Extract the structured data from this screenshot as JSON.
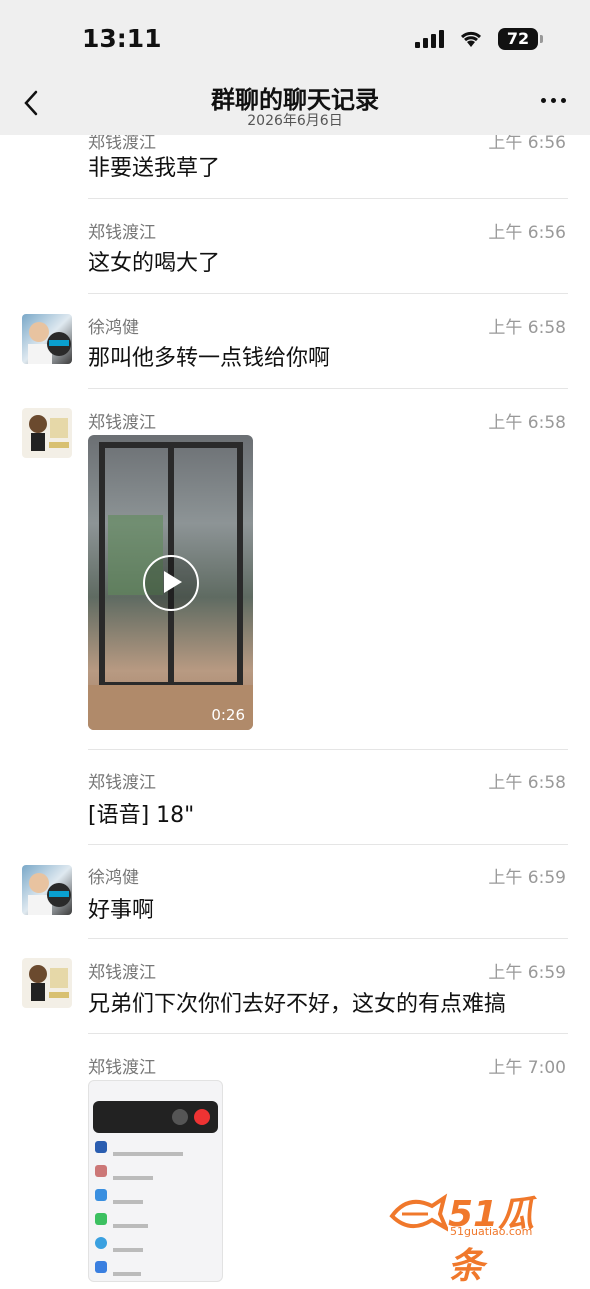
{
  "status_bar": {
    "time": "13:11",
    "battery": "72"
  },
  "header": {
    "title": "群聊的聊天记录",
    "date": "2026年6月6日"
  },
  "messages": [
    {
      "sender": "郑钱渡江",
      "time": "上午 6:56",
      "text": "非要送我草了"
    },
    {
      "sender": "郑钱渡江",
      "time": "上午 6:56",
      "text": "这女的喝大了"
    },
    {
      "sender": "徐鸿健",
      "time": "上午 6:58",
      "text": "那叫他多转一点钱给你啊"
    },
    {
      "sender": "郑钱渡江",
      "time": "上午 6:58",
      "video_duration": "0:26"
    },
    {
      "sender": "郑钱渡江",
      "time": "上午 6:58",
      "text": "[语音] 18\""
    },
    {
      "sender": "徐鸿健",
      "time": "上午 6:59",
      "text": "好事啊"
    },
    {
      "sender": "郑钱渡江",
      "time": "上午 6:59",
      "text": "兄弟们下次你们去好不好，这女的有点难搞"
    },
    {
      "sender": "郑钱渡江",
      "time": "上午 7:00"
    }
  ],
  "watermark": {
    "brand": "51瓜条",
    "url": "51guatiao.com"
  },
  "colors": {
    "nav_bg": "#efefef",
    "watermark": "#f0782b"
  }
}
